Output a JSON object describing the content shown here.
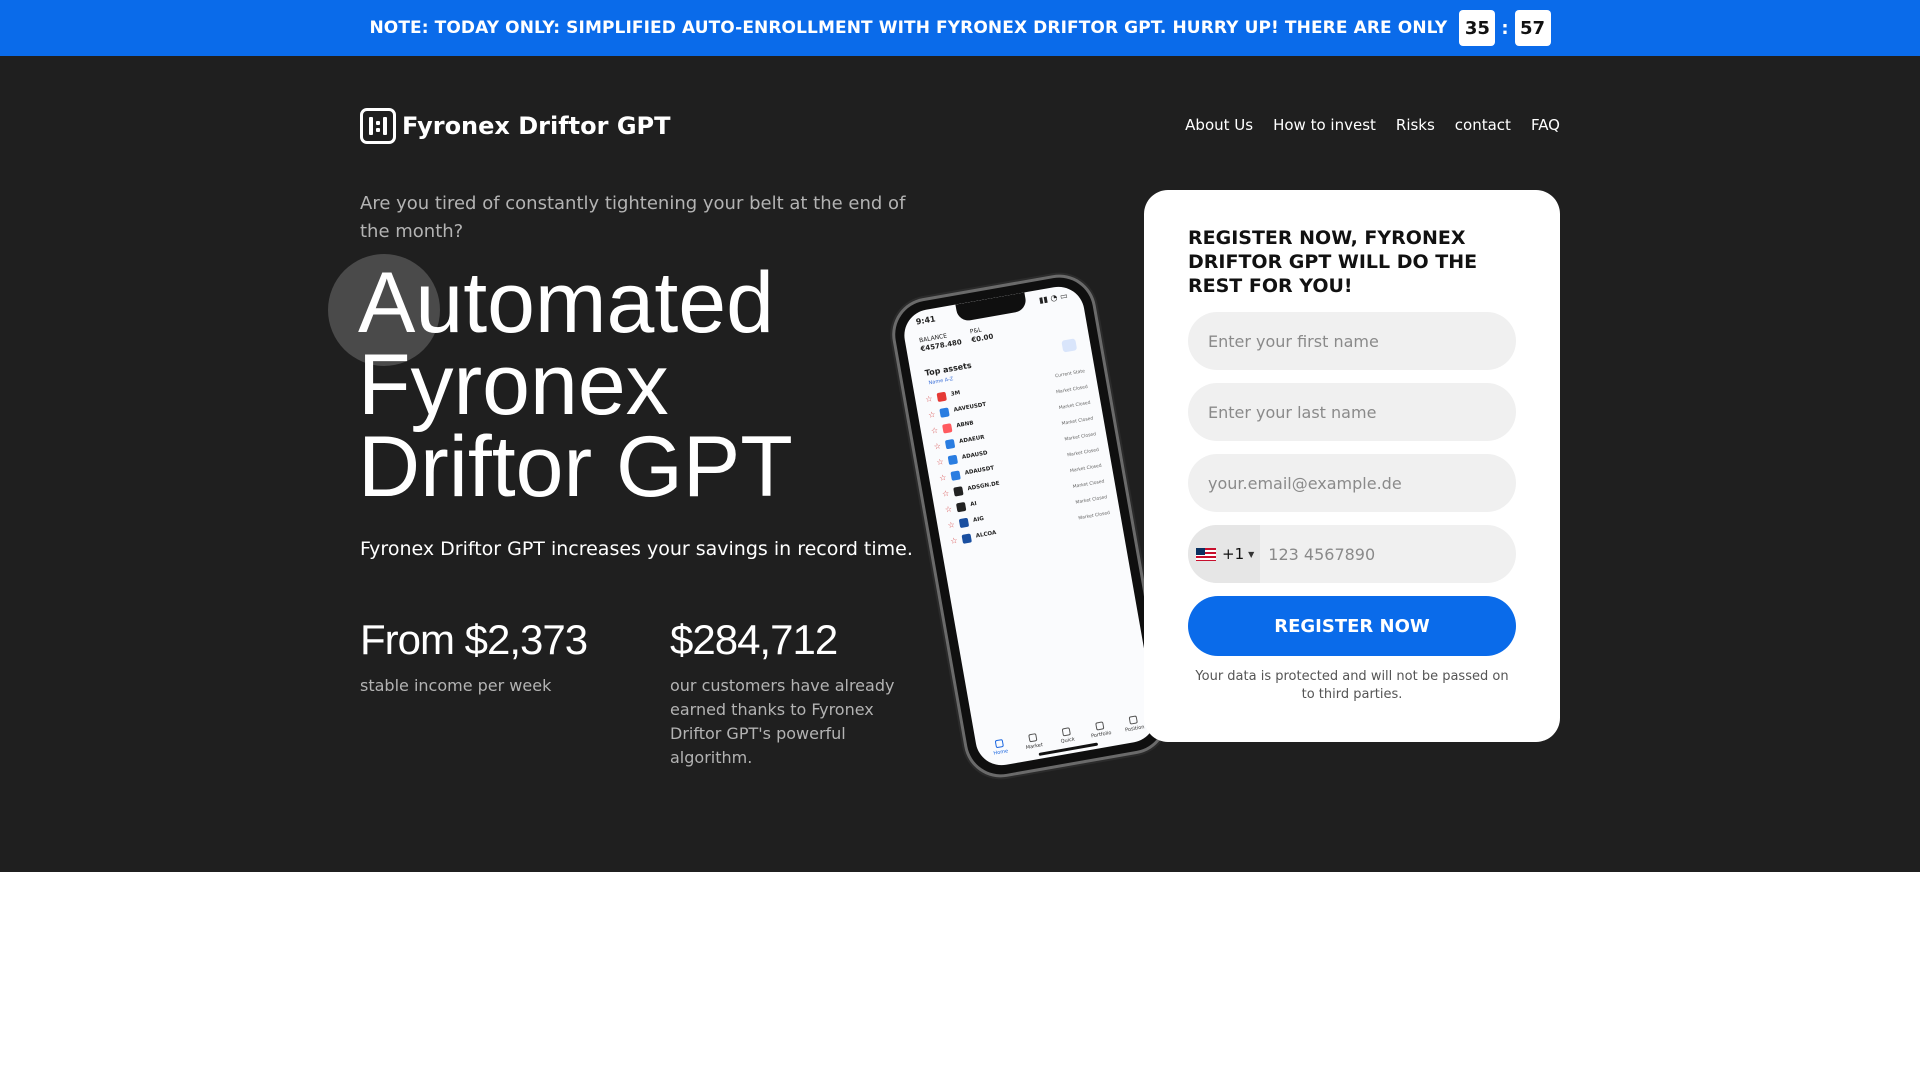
{
  "banner": {
    "text": "NOTE: TODAY ONLY: SIMPLIFIED AUTO-ENROLLMENT WITH FYRONEX DRIFTOR GPT. HURRY UP! THERE ARE ONLY",
    "timer_minutes": "35",
    "timer_separator": ":",
    "timer_seconds": "57"
  },
  "header": {
    "logo_text": "Fyronex Driftor GPT",
    "nav": [
      "About Us",
      "How to invest",
      "Risks",
      "contact",
      "FAQ"
    ]
  },
  "hero": {
    "tagline": "Are you tired of constantly tightening your belt at the end of the month?",
    "headline": [
      "Automated",
      "Fyronex",
      "Driftor GPT"
    ],
    "subline": "Fyronex Driftor GPT increases your savings in record time.",
    "stats": [
      {
        "value": "From $2,373",
        "desc": "stable income per week"
      },
      {
        "value": "$284,712",
        "desc": "our customers have already earned thanks to Fyronex Driftor GPT's powerful algorithm."
      }
    ]
  },
  "phone_app": {
    "time": "9:41",
    "balance_label": "BALANCE",
    "balance_value": "€4578.480",
    "pnl_label": "P&L",
    "pnl_value": "€0.00",
    "section_title": "Top assets",
    "sort_label": "Name A-Z",
    "assets": [
      {
        "name": "3M",
        "status": "Current State",
        "color": "#e53935"
      },
      {
        "name": "AAVEUSDT",
        "status": "Market Closed",
        "color": "#2a7de1"
      },
      {
        "name": "ABNB",
        "status": "Market Closed",
        "color": "#ff5a5f"
      },
      {
        "name": "ADAEUR",
        "status": "Market Closed",
        "color": "#2a7de1"
      },
      {
        "name": "ADAUSD",
        "status": "Market Closed",
        "color": "#2a7de1"
      },
      {
        "name": "ADAUSDT",
        "status": "Market Closed",
        "color": "#2a7de1"
      },
      {
        "name": "ADSGN.DE",
        "status": "Market Closed",
        "color": "#222222"
      },
      {
        "name": "AI",
        "status": "Market Closed",
        "color": "#222222"
      },
      {
        "name": "AIG",
        "status": "Market Closed",
        "color": "#1a4fa0"
      },
      {
        "name": "ALCOA",
        "status": "Market Closed",
        "color": "#1a4fa0"
      }
    ],
    "tabs": [
      "Home",
      "Market",
      "Quick",
      "Portfolio",
      "Position"
    ]
  },
  "form": {
    "title": "REGISTER NOW, FYRONEX DRIFTOR GPT WILL DO THE REST FOR YOU!",
    "first_name_placeholder": "Enter your first name",
    "last_name_placeholder": "Enter your last name",
    "email_placeholder": "your.email@example.de",
    "country_code": "+1",
    "phone_placeholder": "123 4567890",
    "submit_label": "REGISTER NOW",
    "privacy": "Your data is protected and will not be passed on to third parties."
  },
  "colors": {
    "accent": "#0a6bea",
    "hero_bg": "#1f1f1f",
    "card_bg": "#ffffff"
  }
}
